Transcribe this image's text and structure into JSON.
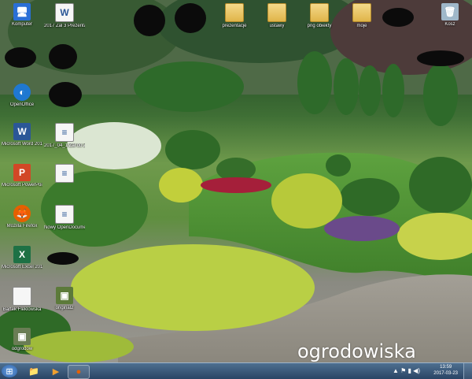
{
  "desktop_icons": [
    {
      "name": "computer-icon",
      "label": "Komputer",
      "glyph": "🖥",
      "color": "#2a6fd6"
    },
    {
      "name": "word-doc-icon",
      "label": "2017 Zal 3 Prezentacja…",
      "glyph": "W",
      "color": "#2b5797"
    },
    {
      "name": "folder-prezentacje-icon",
      "label": "prezentacje",
      "glyph": "",
      "color": "#e0b54a"
    },
    {
      "name": "folder-ustawy-icon",
      "label": "ustawy",
      "glyph": "",
      "color": "#e0b54a"
    },
    {
      "name": "folder-programy-icon",
      "label": "png obiekty",
      "glyph": "",
      "color": "#e0b54a"
    },
    {
      "name": "folder-moje-icon",
      "label": "moje",
      "glyph": "",
      "color": "#e0b54a"
    },
    {
      "name": "recycle-bin-icon",
      "label": "Kosz",
      "glyph": "🗑",
      "color": "#9fb7c9"
    },
    {
      "name": "opera-icon",
      "label": "OpenOffice",
      "glyph": "◐",
      "color": "#1f78d1"
    },
    {
      "name": "word-2010-icon",
      "label": "Microsoft Word 2010",
      "glyph": "W",
      "color": "#2b5797"
    },
    {
      "name": "text-doc-icon",
      "label": "2017_04_1 Zał do Zarz…",
      "glyph": "≡",
      "color": "#7d7d7d"
    },
    {
      "name": "powerpoint-icon",
      "label": "Microsoft PowerPoint 2010",
      "glyph": "P",
      "color": "#d24726"
    },
    {
      "name": "text-doc2-icon",
      "label": "",
      "glyph": "≡",
      "color": "#7d7d7d"
    },
    {
      "name": "firefox-icon",
      "label": "Mozilla Firefox",
      "glyph": "🦊",
      "color": "#e66000"
    },
    {
      "name": "new-odt-icon",
      "label": "Nowy OpenDocument D…",
      "glyph": "≡",
      "color": "#7d7d7d"
    },
    {
      "name": "excel-icon",
      "label": "Microsoft Excel 2010",
      "glyph": "X",
      "color": "#1e7145"
    },
    {
      "name": "file-bartek-icon",
      "label": "Bartek Fleklowska",
      "glyph": "",
      "color": "#ffffff"
    },
    {
      "name": "file-original-icon",
      "label": "original2",
      "glyph": "▣",
      "color": "#5c7a3a"
    },
    {
      "name": "bottom-left-icon",
      "label": "odgrodow",
      "glyph": "▣",
      "color": "#6a7d55"
    }
  ],
  "watermark": "ogrodowiska",
  "taskbar": {
    "start_glyph": "⊞",
    "pinned": [
      {
        "name": "explorer-taskbar-icon",
        "glyph": "📁"
      },
      {
        "name": "media-player-taskbar-icon",
        "glyph": "▶"
      },
      {
        "name": "firefox-taskbar-icon",
        "glyph": "●"
      }
    ],
    "time": "13:59",
    "date": "2017-03-23",
    "tray": "▲ ⚑ ▮ ◀)"
  }
}
